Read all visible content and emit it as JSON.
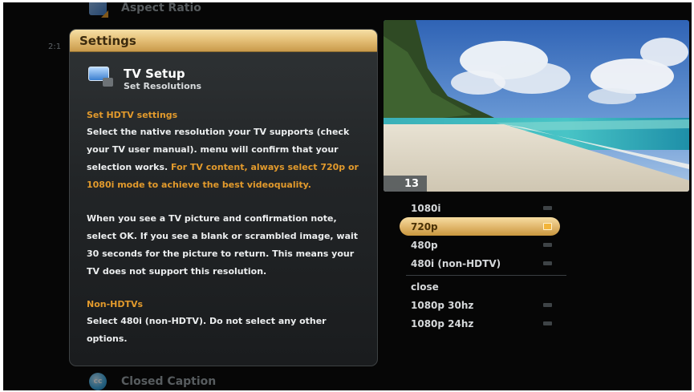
{
  "background_menu": {
    "top_item": {
      "label": "Aspect Ratio",
      "icon": "aspect-ratio-icon"
    },
    "bottom_item": {
      "label": "Closed Caption",
      "icon": "closed-caption-icon"
    },
    "clock_stub": "2:1"
  },
  "settings": {
    "title": "Settings",
    "setup_title": "TV Setup",
    "setup_subtitle": "Set Resolutions",
    "setup_icon": "tv-setup-icon",
    "section1_heading": "Set HDTV settings",
    "section1_text": "Select the native resolution your TV supports (check your TV user manual). menu will confirm that your selection works. ",
    "section1_highlight": "For TV content, always select 720p or 1080i mode to achieve the best videoquality.",
    "section2_text": "When you see a TV picture and confirmation note, select OK. If you see a blank or scrambled image, wait 30 seconds for the picture to return. This means your TV does not support this resolution.",
    "section3_heading": "Non-HDTVs",
    "section3_text": "Select 480i (non-HDTV). Do not select any other options."
  },
  "preview": {
    "channel_number": "13"
  },
  "resolutions": {
    "group1": [
      {
        "label": "1080i",
        "selected": false
      },
      {
        "label": "720p",
        "selected": true
      },
      {
        "label": "480p",
        "selected": false
      },
      {
        "label": "480i (non-HDTV)",
        "selected": false
      }
    ],
    "group2": [
      {
        "label": "close",
        "indicator": false
      },
      {
        "label": "1080p 30hz",
        "indicator": true
      },
      {
        "label": "1080p 24hz",
        "indicator": true
      }
    ]
  },
  "colors": {
    "accent_gold": "#e6c27a",
    "highlight_orange": "#e29a2c",
    "screen_bg": "#060606"
  }
}
